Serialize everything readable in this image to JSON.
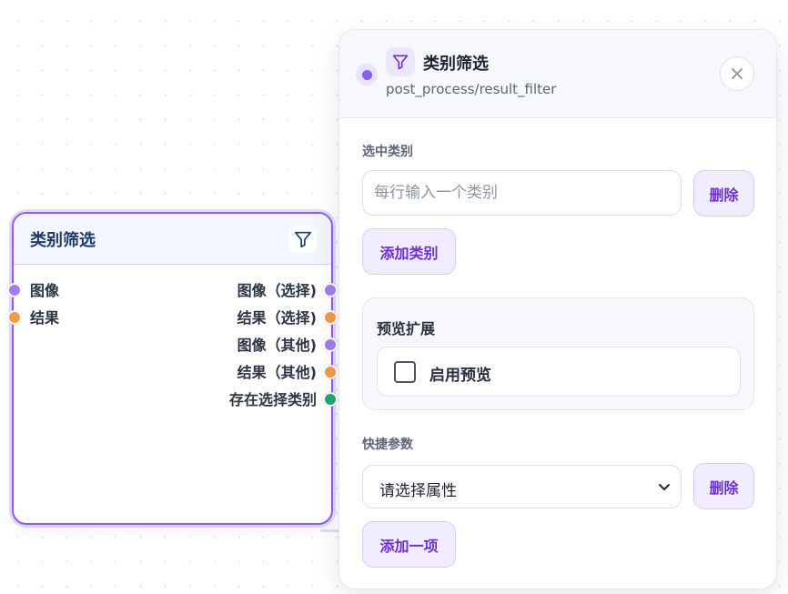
{
  "node": {
    "title": "类别筛选",
    "icon": "filter-icon",
    "inputs": [
      {
        "label": "图像",
        "color": "#a27cf2"
      },
      {
        "label": "结果",
        "color": "#f39a47"
      }
    ],
    "outputs": [
      {
        "label": "图像（选择)",
        "color": "#a27cf2"
      },
      {
        "label": "结果（选择)",
        "color": "#f39a47"
      },
      {
        "label": "图像（其他)",
        "color": "#a27cf2"
      },
      {
        "label": "结果（其他)",
        "color": "#f39a47"
      },
      {
        "label": "存在选择类别",
        "color": "#22a870"
      }
    ]
  },
  "panel": {
    "title": "类别筛选",
    "subtitle": "post_process/result_filter",
    "status_color": "#8b5cf6",
    "close_icon": "close-icon",
    "selected_categories": {
      "label": "选中类别",
      "input_placeholder": "每行输入一个类别",
      "input_value": "",
      "delete_label": "删除",
      "add_label": "添加类别"
    },
    "preview": {
      "title": "预览扩展",
      "checkbox_label": "启用预览",
      "checked": false
    },
    "quick_params": {
      "label": "快捷参数",
      "select_value": "请选择属性",
      "delete_label": "删除",
      "add_label": "添加一项"
    }
  },
  "colors": {
    "accent": "#8b5cf6",
    "button_text": "#6d2fd5",
    "button_bg": "#f1edfe"
  }
}
